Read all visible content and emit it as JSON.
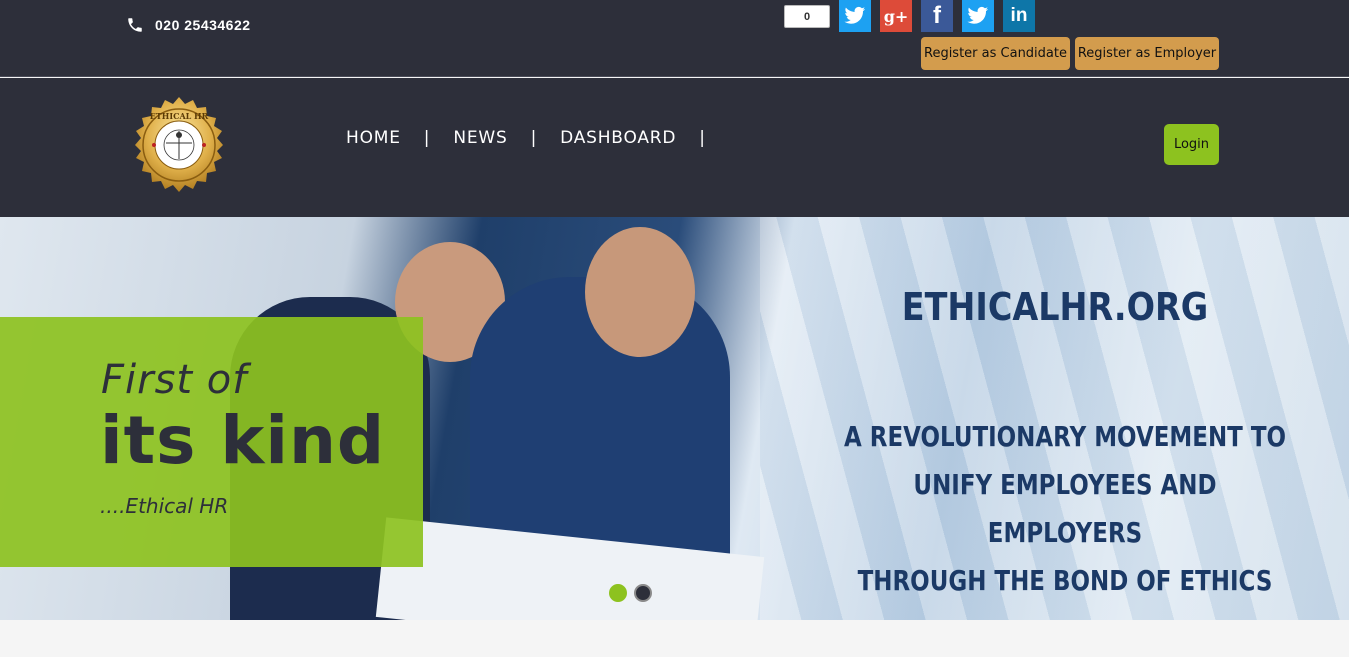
{
  "topbar": {
    "phone": "020 25434622",
    "share_count": "0",
    "social": [
      "twitter-icon",
      "google-plus-icon",
      "facebook-icon",
      "twitter-icon",
      "linkedin-icon"
    ],
    "google_plus_glyph": "g+",
    "facebook_glyph": "f",
    "linkedin_glyph": "in",
    "register_candidate": "Register as Candidate",
    "register_employer": "Register as Employer"
  },
  "logo": {
    "text": "ETHICAL HR"
  },
  "nav": {
    "items": [
      "HOME",
      "NEWS",
      "DASHBOARD"
    ],
    "separator": "|",
    "login": "Login"
  },
  "hero": {
    "line1": "First of",
    "line2": "its kind",
    "line3": "....Ethical HR",
    "brand": "ETHICALHR.ORG",
    "tagline": [
      "A REVOLUTIONARY MOVEMENT TO",
      "UNIFY EMPLOYEES AND EMPLOYERS",
      "THROUGH THE BOND OF ETHICS"
    ],
    "slides_total": 2,
    "active_slide": 1
  },
  "colors": {
    "header_bg": "#2d2f3a",
    "accent_green": "#8dc21f",
    "register_btn": "#d39c4d",
    "brand_blue": "#1b3966"
  }
}
